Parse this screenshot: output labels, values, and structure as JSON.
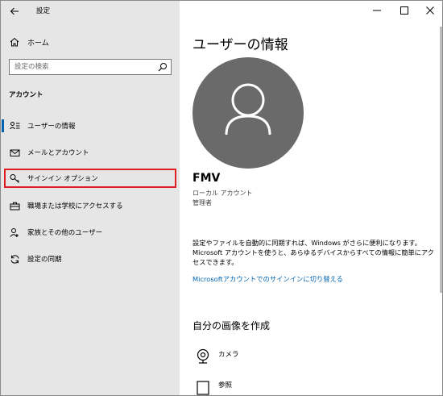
{
  "window": {
    "title": "設定",
    "back_icon": "back-arrow-icon",
    "controls": [
      "minimize-icon",
      "maximize-icon",
      "close-icon"
    ]
  },
  "sidebar": {
    "home_label": "ホーム",
    "search_placeholder": "設定の検索",
    "section_label": "アカウント",
    "items": [
      {
        "label": "ユーザーの情報",
        "icon": "user-info-icon",
        "active": true
      },
      {
        "label": "メールとアカウント",
        "icon": "mail-icon",
        "active": false
      },
      {
        "label": "サインイン オプション",
        "icon": "key-icon",
        "active": false,
        "highlighted": true
      },
      {
        "label": "職場または学校にアクセスする",
        "icon": "briefcase-icon",
        "active": false
      },
      {
        "label": "家族とその他のユーザー",
        "icon": "people-icon",
        "active": false
      },
      {
        "label": "設定の同期",
        "icon": "sync-icon",
        "active": false
      }
    ]
  },
  "main": {
    "page_title": "ユーザーの情報",
    "user_name": "FMV",
    "account_type": "ローカル アカウント",
    "account_role": "管理者",
    "sync_info_line1": "設定やファイルを自動的に同期すれば、Windows がさらに便利になります。",
    "sync_info_line2": "Microsoft アカウントを使うと、あらゆるデバイスからすべての情報に簡単にアク",
    "sync_info_line3": "セスできます。",
    "ms_link": "Microsoftアカウントでのサインインに切り替える",
    "create_heading": "自分の画像を作成",
    "create_items": [
      {
        "label": "カメラ",
        "icon": "camera-icon"
      },
      {
        "label": "参照",
        "icon": "browse-icon"
      }
    ]
  },
  "colors": {
    "sidebar_bg": "#e6e6e6",
    "accent": "#0063b1",
    "highlight_box": "#e02020",
    "avatar_bg": "#6a6a6a"
  }
}
